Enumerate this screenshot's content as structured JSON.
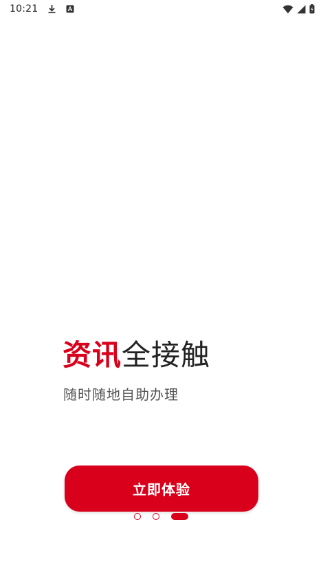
{
  "status_bar": {
    "time": "10:21",
    "icons_left": [
      "download-icon",
      "a-badge-icon"
    ],
    "icons_right": [
      "wifi-icon",
      "cellular-signal-icon",
      "battery-icon"
    ]
  },
  "onboarding": {
    "headline_accent": "资讯",
    "headline_rest": "全接触",
    "subtitle": "随时随地自助办理",
    "cta_label": "立即体验",
    "pager": {
      "total": 3,
      "active_index": 2
    }
  },
  "colors": {
    "accent": "#d9001b",
    "text_dark": "#222222",
    "text_muted": "#555555",
    "background": "#ffffff"
  }
}
